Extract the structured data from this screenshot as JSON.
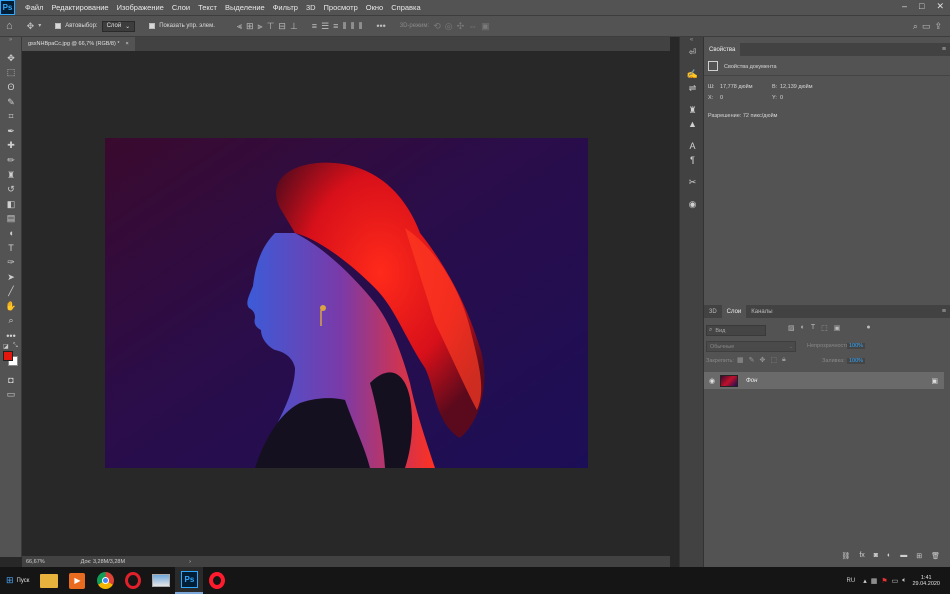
{
  "menubar": {
    "items": [
      "Файл",
      "Редактирование",
      "Изображение",
      "Слои",
      "Текст",
      "Выделение",
      "Фильтр",
      "3D",
      "Просмотр",
      "Окно",
      "Справка"
    ]
  },
  "options": {
    "autoselect_label": "Автовыбор:",
    "autoselect_value": "Слой",
    "show_controls_label": "Показать упр. элем.",
    "mode3d_label": "3D-режим:"
  },
  "document": {
    "tab_title": "gsxNHBpaCc.jpg @ 66,7% (RGB/8) *",
    "tab_close": "×"
  },
  "status": {
    "zoom": "66,67%",
    "doc": "Док: 3,28M/3,28M",
    "arrow": "›"
  },
  "properties": {
    "tab": "Свойства",
    "section": "Свойства документа",
    "w_label": "Ш:",
    "w_value": "17,778 дюйм",
    "h_label": "В:",
    "h_value": "12,139 дюйм",
    "x_label": "X:",
    "x_value": "0",
    "y_label": "Y:",
    "y_value": "0",
    "resolution": "Разрешение: 72 пикс/дюйм"
  },
  "layers": {
    "tabs": [
      "3D",
      "Слои",
      "Каналы"
    ],
    "active_tab": 1,
    "search": "Вид",
    "blend_mode": "Обычные",
    "opacity_label": "Непрозрачность:",
    "opacity_value": "100%",
    "lock_label": "Закрепить:",
    "fill_label": "Заливка:",
    "fill_value": "100%",
    "layer_name": "Фон"
  },
  "taskbar": {
    "start": "Пуск",
    "apps": [
      "explorer",
      "media-player",
      "chrome",
      "opera",
      "image-viewer",
      "photoshop",
      "opera"
    ],
    "photoshop_label": "Ps",
    "lang": "RU",
    "time": "1:41",
    "date": "29.04.2020"
  },
  "colors": {
    "foreground": "#e3170e",
    "background": "#ffffff",
    "accent": "#31a8ff"
  }
}
